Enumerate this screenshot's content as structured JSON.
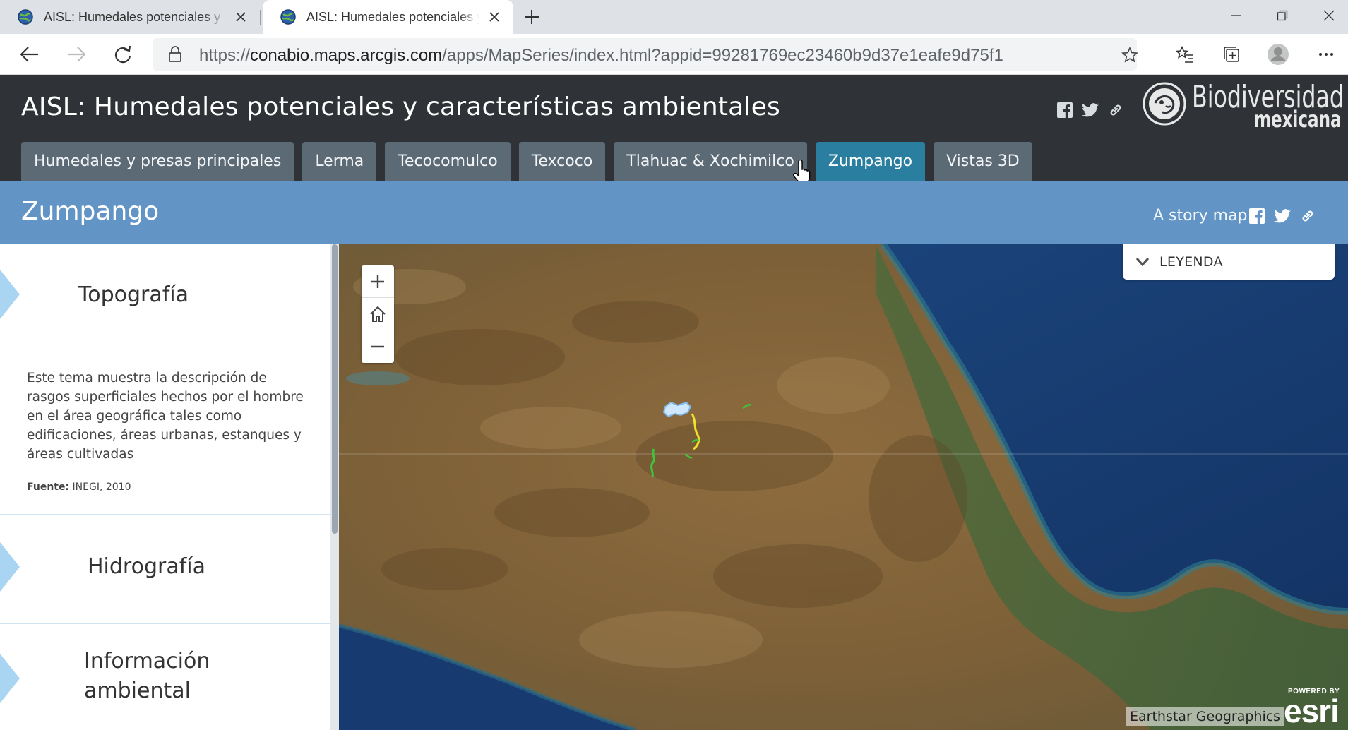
{
  "browser": {
    "tabs": [
      {
        "title": "AISL: Humedales potenciales y características ambientales",
        "active": false
      },
      {
        "title": "AISL: Humedales potenciales y características ambientales",
        "active": true
      }
    ],
    "url": {
      "scheme": "https://",
      "host": "conabio.maps.arcgis.com",
      "path": "/apps/MapSeries/index.html?appid=99281769ec23460b9d37e1eafe9d75f1"
    }
  },
  "header": {
    "title": "AISL: Humedales potenciales y características ambientales",
    "share_icons": [
      "facebook-icon",
      "twitter-icon",
      "link-icon"
    ],
    "logo": {
      "word1": "Biodiversidad",
      "word2": "mexicana"
    }
  },
  "series_tabs": [
    {
      "label": "Humedales y presas principales",
      "active": false
    },
    {
      "label": "Lerma",
      "active": false
    },
    {
      "label": "Tecocomulco",
      "active": false
    },
    {
      "label": "Texcoco",
      "active": false
    },
    {
      "label": "Tlahuac & Xochimilco",
      "active": false
    },
    {
      "label": "Zumpango",
      "active": true
    },
    {
      "label": "Vistas 3D",
      "active": false
    }
  ],
  "section": {
    "title": "Zumpango",
    "story_map_label": "A story map"
  },
  "panel": {
    "items": [
      {
        "title": "Topografía",
        "expanded": true,
        "description": "Este tema muestra la descripción de rasgos superficiales hechos por el hombre en el área geográfica tales como edificaciones, áreas urbanas, estanques y áreas cultivadas",
        "source_label": "Fuente:",
        "source_value": "INEGI, 2010"
      },
      {
        "title": "Hidrografía",
        "expanded": false
      },
      {
        "title": "Información ambiental",
        "expanded": false
      }
    ]
  },
  "map": {
    "legend_label": "LEYENDA",
    "attribution": "Earthstar Geographics",
    "esri_powered": "POWERED BY",
    "esri_word": "esri"
  },
  "colors": {
    "header_bg": "#2f3337",
    "tab_bg": "#5b6a75",
    "tab_active_bg": "#2a7fa0",
    "section_bar": "#6295c6",
    "accordion_arrow": "#a9d4f2",
    "land": "#8a6a3e",
    "ocean": "#16396e"
  }
}
